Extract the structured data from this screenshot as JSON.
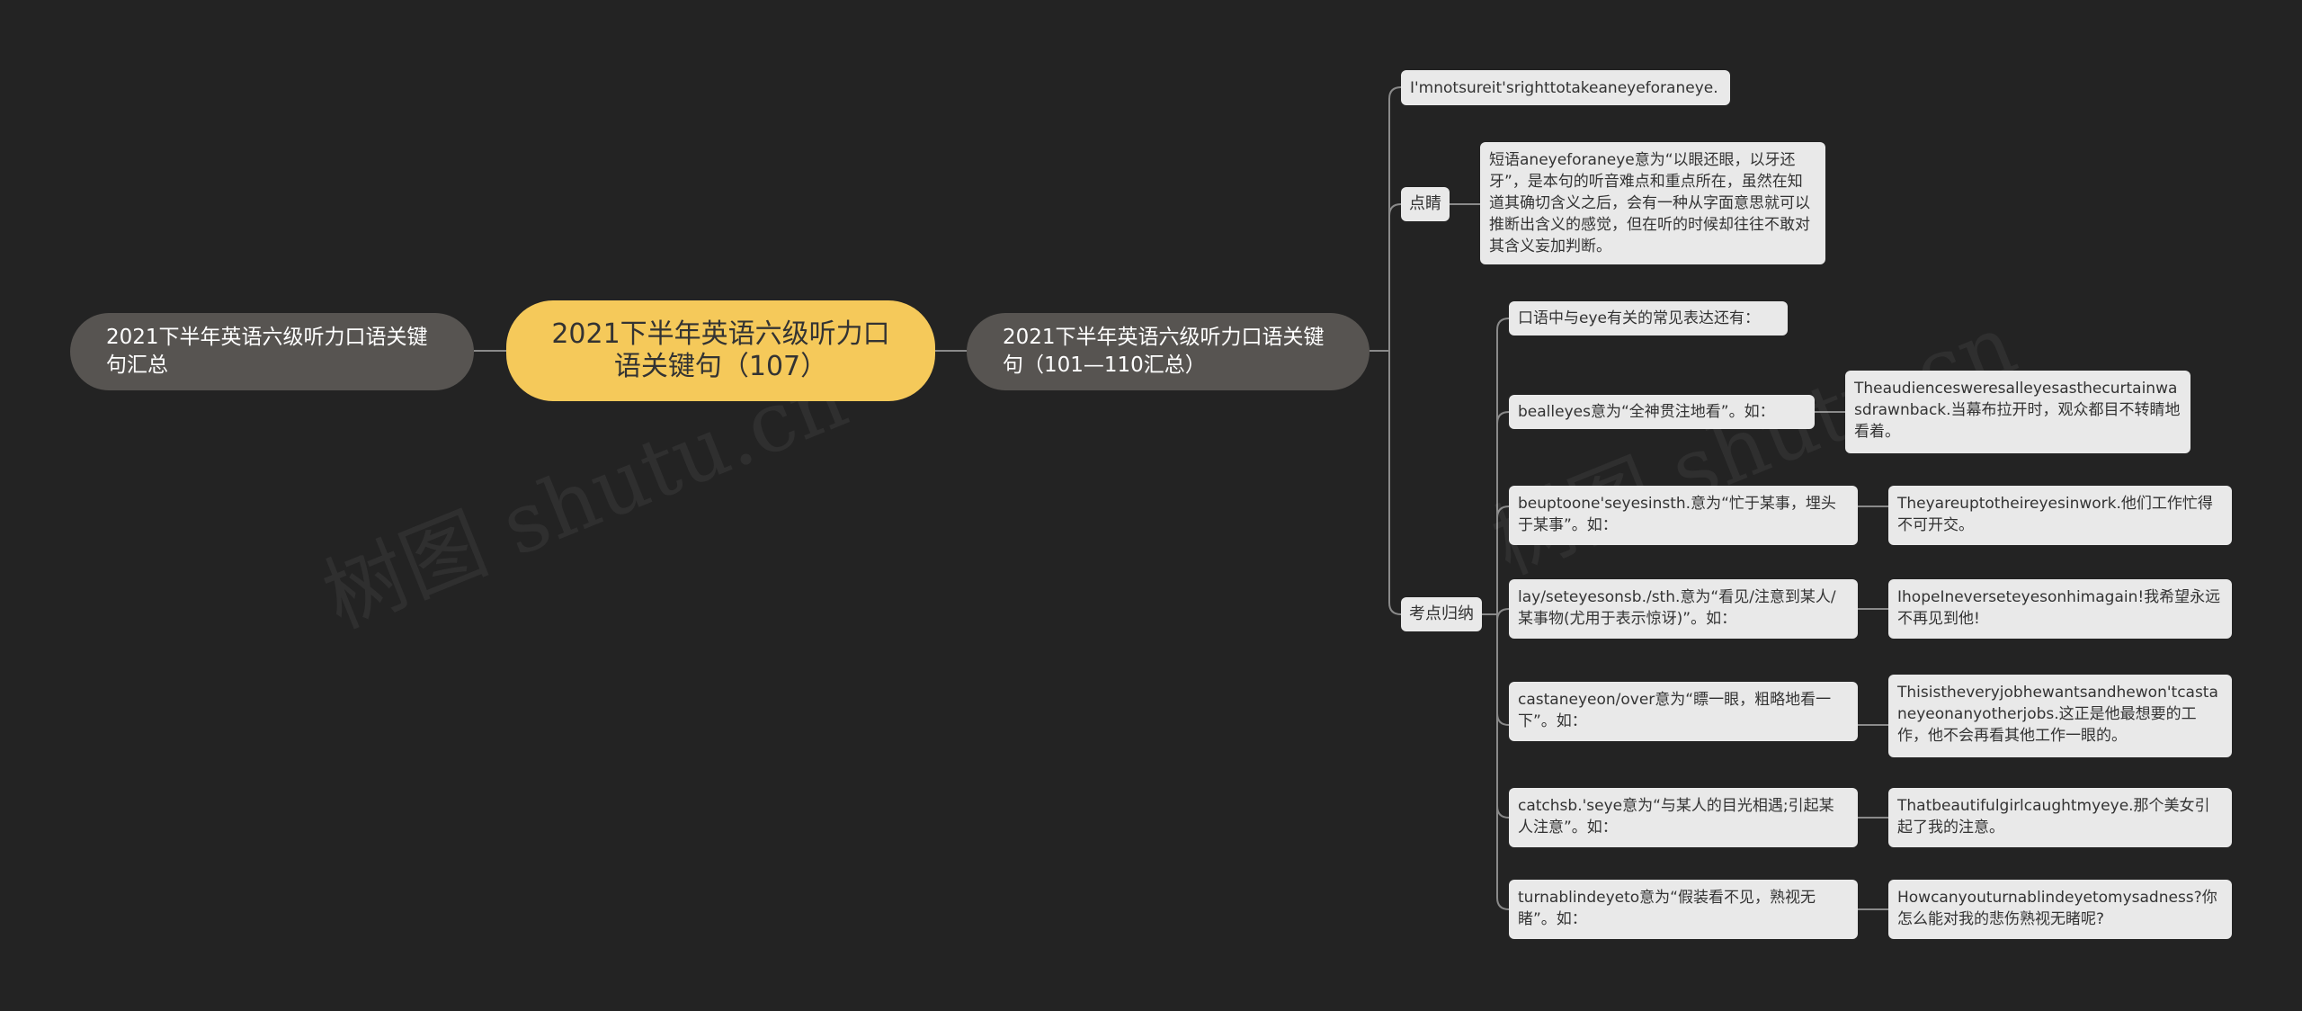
{
  "root": {
    "title": "2021下半年英语六级听力口语关键句（107）"
  },
  "left_branch": {
    "label": "2021下半年英语六级听力口语关键句汇总"
  },
  "right_branch": {
    "label": "2021下半年英语六级听力口语关键句（101—110汇总）"
  },
  "top_sentence": "I'mnotsureit'srighttotakeaneyeforaneye.",
  "dianjing": {
    "label": "点睛",
    "text": "短语aneyeforaneye意为“以眼还眼，以牙还牙”，是本句的听音难点和重点所在，虽然在知道其确切含义之后，会有一种从字面意思就可以推断出含义的感觉，但在听的时候却往往不敢对其含义妄加判断。"
  },
  "kaodian": {
    "label": "考点归纳",
    "intro": "口语中与eye有关的常见表达还有：",
    "items": [
      {
        "phrase": "bealleyes意为“全神贯注地看”。如：",
        "example": "Theaudiencesweresalleyesasthecurtainwasdrawnback.当幕布拉开时，观众都目不转睛地看着。"
      },
      {
        "phrase": "beuptoone'seyesinsth.意为“忙于某事，埋头于某事”。如：",
        "example": "Theyareuptotheireyesinwork.他们工作忙得不可开交。"
      },
      {
        "phrase": "lay/seteyesonsb./sth.意为“看见/注意到某人/某事物(尤用于表示惊讶)”。如：",
        "example": "IhopeIneverseteyesonhimagain!我希望永远不再见到他!"
      },
      {
        "phrase": "castaneyeon/over意为“瞟一眼，粗略地看一下”。如：",
        "example": "Thisistheveryjobhewantsandhewon'tcastaneyeonanyotherjobs.这正是他最想要的工作，他不会再看其他工作一眼的。"
      },
      {
        "phrase": "catchsb.'seye意为“与某人的目光相遇;引起某人注意”。如：",
        "example": "Thatbeautifulgirlcaughtmyeye.那个美女引起了我的注意。"
      },
      {
        "phrase": "turnablindeyeto意为“假装看不见，熟视无睹”。如：",
        "example": "Howcanyouturnablindeyetomysadness?你怎么能对我的悲伤熟视无睹呢?"
      }
    ]
  },
  "watermark": "树图 shutu.cn",
  "colors": {
    "background": "#232323",
    "root": "#f5c95a",
    "branch": "#575451",
    "leaf": "#e9e9e9",
    "line": "#8a8a8a"
  }
}
